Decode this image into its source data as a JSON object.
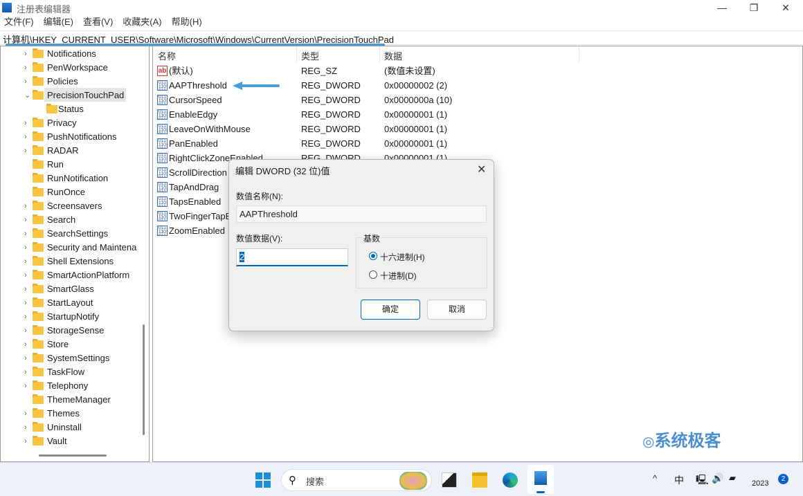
{
  "window": {
    "title": "注册表编辑器",
    "minimize": "—",
    "maximize": "❐",
    "close": "✕"
  },
  "menu": [
    "文件(F)",
    "编辑(E)",
    "查看(V)",
    "收藏夹(A)",
    "帮助(H)"
  ],
  "address": "计算机\\HKEY_CURRENT_USER\\Software\\Microsoft\\Windows\\CurrentVersion\\PrecisionTouchPad",
  "tree": [
    {
      "label": "Notifications",
      "expander": "›"
    },
    {
      "label": "PenWorkspace",
      "expander": "›"
    },
    {
      "label": "Policies",
      "expander": "›"
    },
    {
      "label": "PrecisionTouchPad",
      "expander": "⌄",
      "selected": true
    },
    {
      "label": "Status",
      "child": true
    },
    {
      "label": "Privacy",
      "expander": "›"
    },
    {
      "label": "PushNotifications",
      "expander": "›"
    },
    {
      "label": "RADAR",
      "expander": "›"
    },
    {
      "label": "Run"
    },
    {
      "label": "RunNotification"
    },
    {
      "label": "RunOnce"
    },
    {
      "label": "Screensavers",
      "expander": "›"
    },
    {
      "label": "Search",
      "expander": "›"
    },
    {
      "label": "SearchSettings",
      "expander": "›"
    },
    {
      "label": "Security and Maintena",
      "expander": "›"
    },
    {
      "label": "Shell Extensions",
      "expander": "›"
    },
    {
      "label": "SmartActionPlatform",
      "expander": "›"
    },
    {
      "label": "SmartGlass",
      "expander": "›"
    },
    {
      "label": "StartLayout",
      "expander": "›"
    },
    {
      "label": "StartupNotify",
      "expander": "›"
    },
    {
      "label": "StorageSense",
      "expander": "›"
    },
    {
      "label": "Store",
      "expander": "›"
    },
    {
      "label": "SystemSettings",
      "expander": "›"
    },
    {
      "label": "TaskFlow",
      "expander": "›"
    },
    {
      "label": "Telephony",
      "expander": "›"
    },
    {
      "label": "ThemeManager"
    },
    {
      "label": "Themes",
      "expander": "›"
    },
    {
      "label": "Uninstall",
      "expander": "›"
    },
    {
      "label": "Vault",
      "expander": "›"
    }
  ],
  "list": {
    "headers": [
      "名称",
      "类型",
      "数据"
    ],
    "rows": [
      {
        "icon": "string",
        "name": "(默认)",
        "type": "REG_SZ",
        "data": "(数值未设置)"
      },
      {
        "icon": "dword",
        "name": "AAPThreshold",
        "type": "REG_DWORD",
        "data": "0x00000002 (2)"
      },
      {
        "icon": "dword",
        "name": "CursorSpeed",
        "type": "REG_DWORD",
        "data": "0x0000000a (10)"
      },
      {
        "icon": "dword",
        "name": "EnableEdgy",
        "type": "REG_DWORD",
        "data": "0x00000001 (1)"
      },
      {
        "icon": "dword",
        "name": "LeaveOnWithMouse",
        "type": "REG_DWORD",
        "data": "0x00000001 (1)"
      },
      {
        "icon": "dword",
        "name": "PanEnabled",
        "type": "REG_DWORD",
        "data": "0x00000001 (1)"
      },
      {
        "icon": "dword",
        "name": "RightClickZoneEnabled",
        "type": "REG_DWORD",
        "data": "0x00000001 (1)"
      },
      {
        "icon": "dword",
        "name": "ScrollDirection",
        "type": "",
        "data": ""
      },
      {
        "icon": "dword",
        "name": "TapAndDrag",
        "type": "",
        "data": ""
      },
      {
        "icon": "dword",
        "name": "TapsEnabled",
        "type": "",
        "data": ""
      },
      {
        "icon": "dword",
        "name": "TwoFingerTapEnabled",
        "type": "",
        "data": ""
      },
      {
        "icon": "dword",
        "name": "ZoomEnabled",
        "type": "",
        "data": ""
      }
    ]
  },
  "dialog": {
    "title": "编辑 DWORD (32 位)值",
    "name_label": "数值名称(N):",
    "name_value": "AAPThreshold",
    "data_label": "数值数据(V):",
    "data_value": "2",
    "base_label": "基数",
    "hex_label": "十六进制(H)",
    "dec_label": "十进制(D)",
    "base_selected": "hex",
    "ok": "确定",
    "cancel": "取消"
  },
  "watermark": "系统极客",
  "taskbar": {
    "search_placeholder": "搜索",
    "tray_ime": "中",
    "tray_chevron": "^",
    "year": "2023",
    "notification_count": "2"
  },
  "colors": {
    "accent": "#0067c0",
    "arrow": "#4a9ed8"
  }
}
